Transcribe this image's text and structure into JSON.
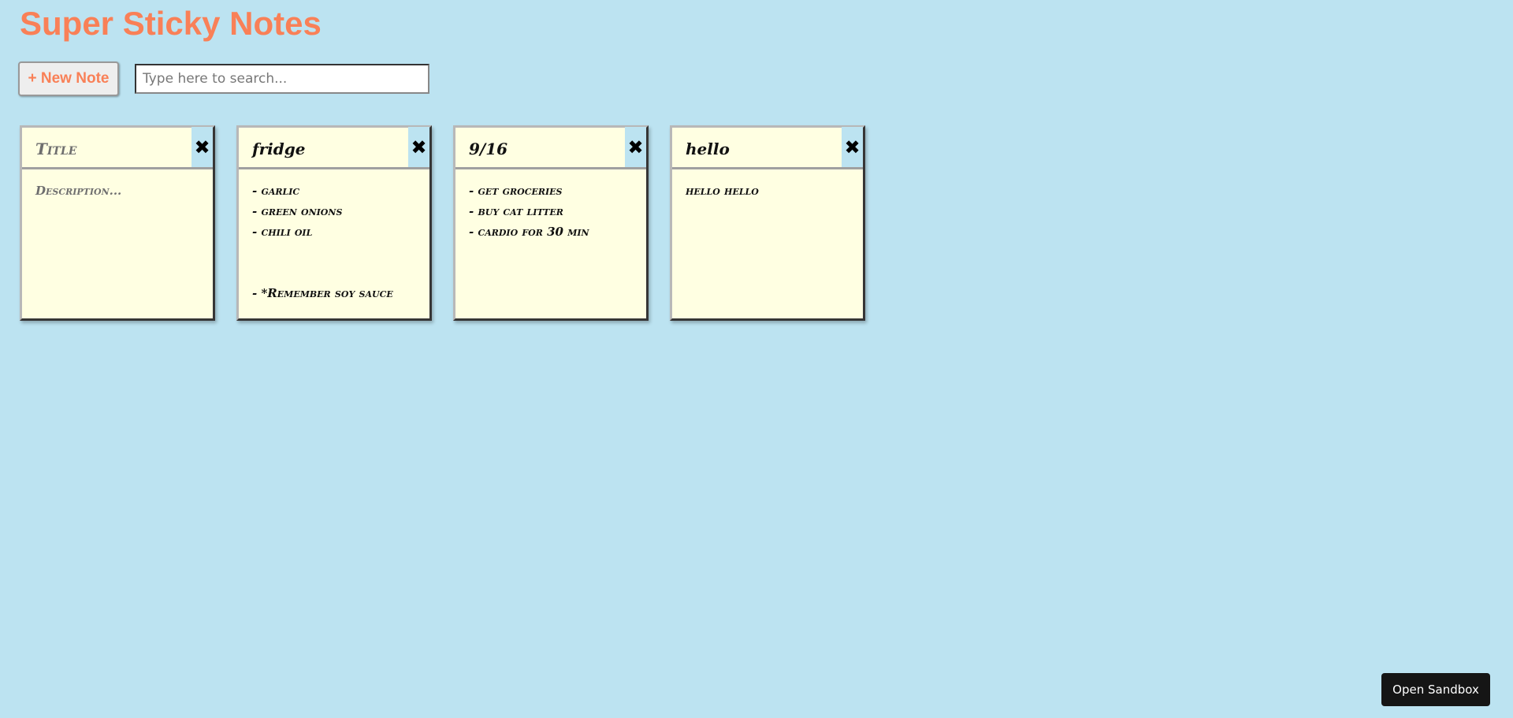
{
  "app": {
    "title": "Super Sticky Notes"
  },
  "toolbar": {
    "new_note_label": "+ New Note",
    "search_placeholder": "Type here to search...",
    "search_value": ""
  },
  "notes": [
    {
      "title": "",
      "title_placeholder": "Title",
      "description": "",
      "description_placeholder": "Description...",
      "close_icon": "✖"
    },
    {
      "title": "fridge",
      "title_placeholder": "Title",
      "description": "- garlic\n- green onions\n- chili oil\n\n\n- *Remember soy sauce",
      "description_placeholder": "Description...",
      "close_icon": "✖"
    },
    {
      "title": "9/16",
      "title_placeholder": "Title",
      "description": "- get groceries\n- buy cat litter\n- cardio for 30 min",
      "description_placeholder": "Description...",
      "close_icon": "✖"
    },
    {
      "title": "hello",
      "title_placeholder": "Title",
      "description": "hello hello",
      "description_placeholder": "Description...",
      "close_icon": "✖"
    }
  ],
  "sandbox": {
    "label": "Open Sandbox"
  },
  "colors": {
    "background": "#bce3f1",
    "accent": "#f98057",
    "note": "#ffffe2"
  }
}
